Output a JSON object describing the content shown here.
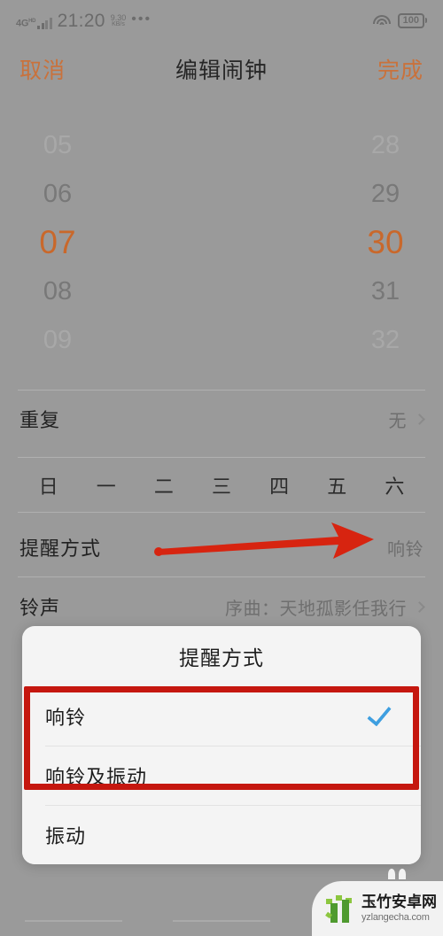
{
  "status_bar": {
    "network_type": "4G",
    "network_sup": "HD",
    "time": "21:20",
    "speed_value": "9.30",
    "speed_unit": "KB/s",
    "overflow": "•••",
    "wifi_icon": "wifi-icon",
    "battery": "100"
  },
  "nav_bar": {
    "cancel": "取消",
    "title": "编辑闹钟",
    "done": "完成"
  },
  "time_picker": {
    "hours": [
      "05",
      "06",
      "07",
      "08",
      "09"
    ],
    "minutes": [
      "28",
      "29",
      "30",
      "31",
      "32"
    ],
    "selected_hour": "07",
    "selected_minute": "30",
    "accent_color": "#c9682b"
  },
  "rows": {
    "repeat": {
      "label": "重复",
      "value": "无"
    },
    "weekdays": [
      "日",
      "一",
      "二",
      "三",
      "四",
      "五",
      "六"
    ],
    "reminder_mode": {
      "label": "提醒方式",
      "value": "响铃"
    },
    "ringtone": {
      "label": "铃声",
      "value": "序曲：天地孤影任我行"
    }
  },
  "annotation": {
    "arrow_color": "#d72410",
    "box_color": "#c5170f"
  },
  "dialog": {
    "title": "提醒方式",
    "options": [
      {
        "label": "响铃",
        "checked": true
      },
      {
        "label": "响铃及振动",
        "checked": false
      },
      {
        "label": "振动",
        "checked": false
      }
    ],
    "check_color": "#3f9fe0"
  },
  "watermark": {
    "name_cn": "玉竹安卓网",
    "domain": "yzlangecha.com"
  }
}
